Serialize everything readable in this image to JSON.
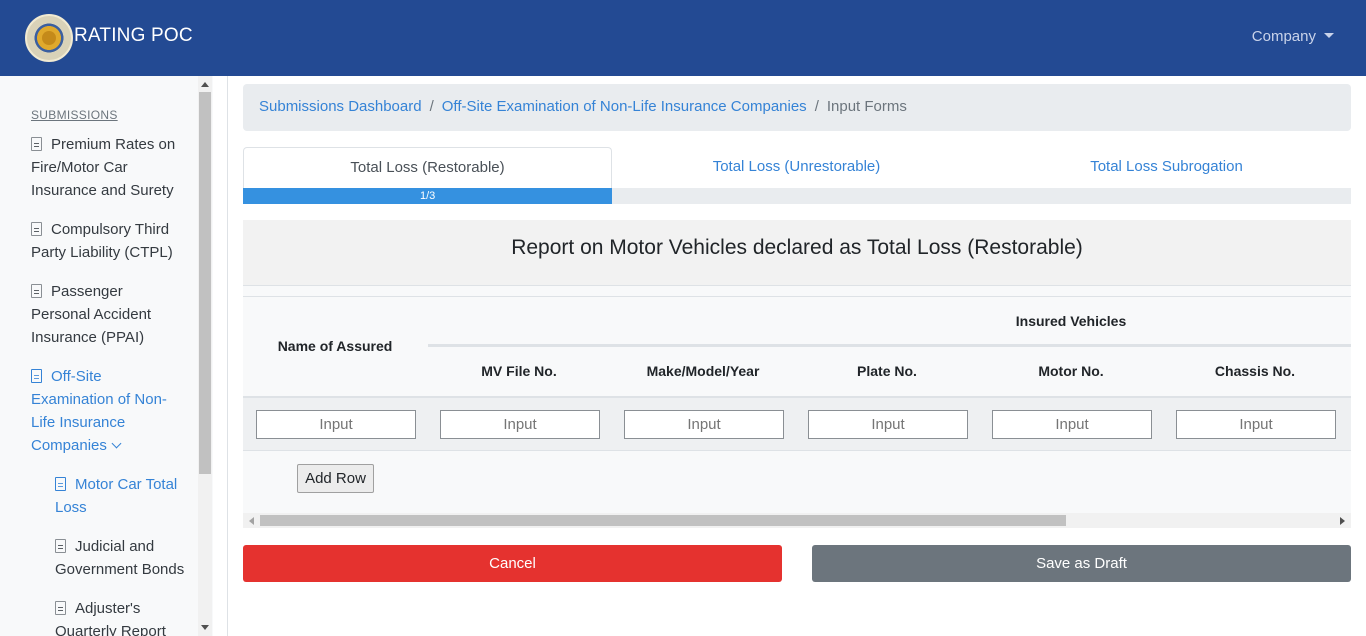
{
  "navbar": {
    "brand": "RATING POC",
    "company_menu": "Company"
  },
  "sidebar": {
    "heading": "SUBMISSIONS",
    "items": [
      {
        "label": "Premium Rates on Fire/Motor Car Insurance and Surety"
      },
      {
        "label": "Compulsory Third Party Liability (CTPL)"
      },
      {
        "label": "Passenger Personal Accident Insurance (PPAI)"
      },
      {
        "label": "Off-Site Examination of Non-Life Insurance Companies",
        "active": true,
        "expanded": true
      },
      {
        "label": "Motor Car Total Loss",
        "active": true,
        "sub": true
      },
      {
        "label": "Judicial and Government Bonds",
        "sub": true
      },
      {
        "label": "Adjuster's Quarterly Report",
        "sub": true
      }
    ]
  },
  "breadcrumb": {
    "items": [
      "Submissions Dashboard",
      "Off-Site Examination of Non-Life Insurance Companies"
    ],
    "current": "Input Forms"
  },
  "tabs": [
    {
      "label": "Total Loss (Restorable)",
      "active": true
    },
    {
      "label": "Total Loss (Unrestorable)"
    },
    {
      "label": "Total Loss Subrogation"
    }
  ],
  "progress": {
    "label": "1/3",
    "value": 0.3333
  },
  "form": {
    "title": "Report on Motor Vehicles declared as Total Loss (Restorable)",
    "group_header": "Insured Vehicles",
    "columns": [
      "Name of Assured",
      "MV File No.",
      "Make/Model/Year",
      "Plate No.",
      "Motor No.",
      "Chassis No."
    ],
    "input_placeholder": "Input",
    "add_row_label": "Add Row"
  },
  "actions": {
    "cancel": "Cancel",
    "save_draft": "Save as Draft"
  },
  "colors": {
    "navbar": "#234a93",
    "link": "#3583d6",
    "progress": "#3591e0",
    "cancel": "#e5322f",
    "draft": "#6c757d"
  }
}
